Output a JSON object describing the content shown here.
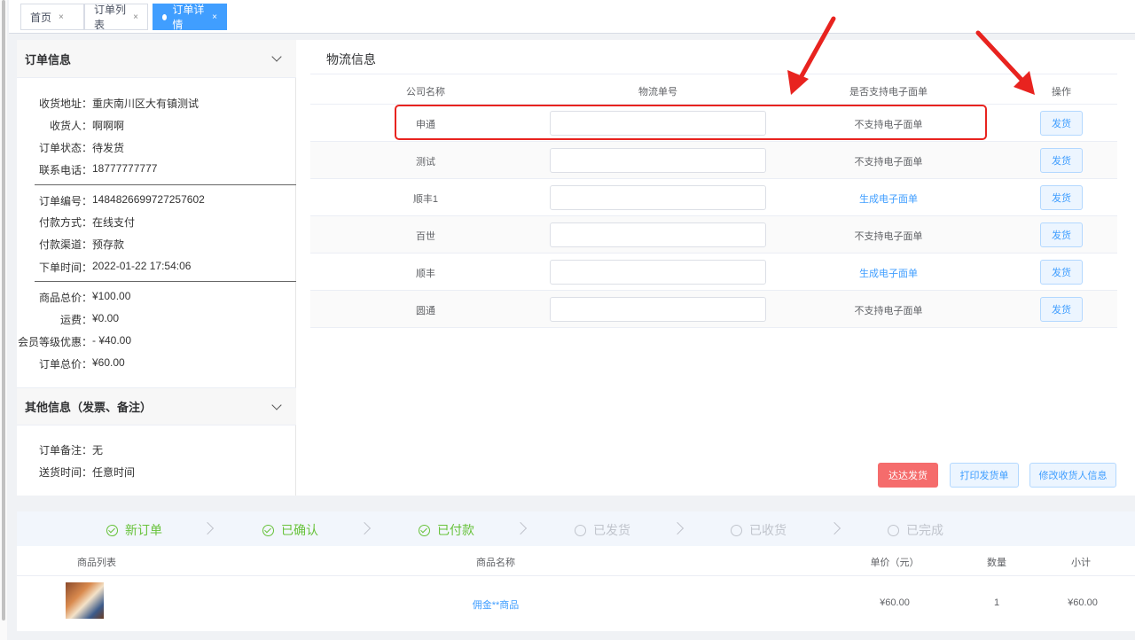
{
  "tabs": [
    {
      "label": "首页",
      "close": "×"
    },
    {
      "label": "订单列表",
      "close": "×"
    },
    {
      "label": "订单详情",
      "close": "×",
      "active": true
    }
  ],
  "order_info": {
    "title": "订单信息",
    "group1": [
      {
        "k": "收货地址：",
        "v": "重庆南川区大有镇测试"
      },
      {
        "k": "收货人：",
        "v": "啊啊啊"
      },
      {
        "k": "订单状态：",
        "v": "待发货"
      },
      {
        "k": "联系电话：",
        "v": "18777777777"
      }
    ],
    "group2": [
      {
        "k": "订单编号：",
        "v": "1484826699727257602"
      },
      {
        "k": "付款方式：",
        "v": "在线支付"
      },
      {
        "k": "付款渠道：",
        "v": "预存款"
      },
      {
        "k": "下单时间：",
        "v": "2022-01-22 17:54:06"
      }
    ],
    "group3": [
      {
        "k": "商品总价：",
        "v": "¥100.00"
      },
      {
        "k": "运费：",
        "v": "¥0.00"
      },
      {
        "k": "会员等级优惠：",
        "v": "- ¥40.00"
      },
      {
        "k": "订单总价：",
        "v": "¥60.00"
      }
    ]
  },
  "other_info": {
    "title": "其他信息（发票、备注）",
    "rows": [
      {
        "k": "订单备注：",
        "v": "无"
      },
      {
        "k": "送货时间：",
        "v": "任意时间"
      }
    ]
  },
  "logistics": {
    "title": "物流信息",
    "columns": [
      "公司名称",
      "物流单号",
      "是否支持电子面单",
      "操作"
    ],
    "rows": [
      {
        "company": "申通",
        "support": "不支持电子面单",
        "link": false,
        "action": "发货"
      },
      {
        "company": "测试",
        "support": "不支持电子面单",
        "link": false,
        "action": "发货"
      },
      {
        "company": "顺丰1",
        "support": "生成电子面单",
        "link": true,
        "action": "发货"
      },
      {
        "company": "百世",
        "support": "不支持电子面单",
        "link": false,
        "action": "发货"
      },
      {
        "company": "顺丰",
        "support": "生成电子面单",
        "link": true,
        "action": "发货"
      },
      {
        "company": "圆通",
        "support": "不支持电子面单",
        "link": false,
        "action": "发货"
      }
    ],
    "buttons": {
      "dada": "达达发货",
      "print": "打印发货单",
      "edit_receiver": "修改收货人信息"
    }
  },
  "steps": [
    {
      "label": "新订单",
      "done": true
    },
    {
      "label": "已确认",
      "done": true
    },
    {
      "label": "已付款",
      "done": true
    },
    {
      "label": "已发货",
      "done": false
    },
    {
      "label": "已收货",
      "done": false
    },
    {
      "label": "已完成",
      "done": false
    }
  ],
  "goods": {
    "columns": [
      "商品列表",
      "商品名称",
      "单价（元）",
      "数量",
      "小计"
    ],
    "rows": [
      {
        "name": "佣金**商品",
        "price": "¥60.00",
        "qty": "1",
        "subtotal": "¥60.00"
      }
    ]
  },
  "colors": {
    "accent": "#409eff",
    "success": "#67c23a",
    "danger": "#f56c6c",
    "annotation": "#e8231f"
  }
}
